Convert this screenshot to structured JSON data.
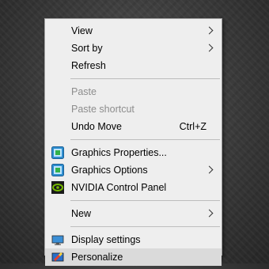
{
  "menu": {
    "view": "View",
    "sort_by": "Sort by",
    "refresh": "Refresh",
    "paste": "Paste",
    "paste_shortcut": "Paste shortcut",
    "undo_move": "Undo Move",
    "undo_shortcut": "Ctrl+Z",
    "graphics_properties": "Graphics Properties...",
    "graphics_options": "Graphics Options",
    "nvidia_control_panel": "NVIDIA Control Panel",
    "new": "New",
    "display_settings": "Display settings",
    "personalize": "Personalize"
  },
  "icons": {
    "graphics_properties": "intel-graphics-icon",
    "graphics_options": "intel-graphics-icon",
    "nvidia": "nvidia-icon",
    "display_settings": "display-icon",
    "personalize": "personalize-icon"
  }
}
